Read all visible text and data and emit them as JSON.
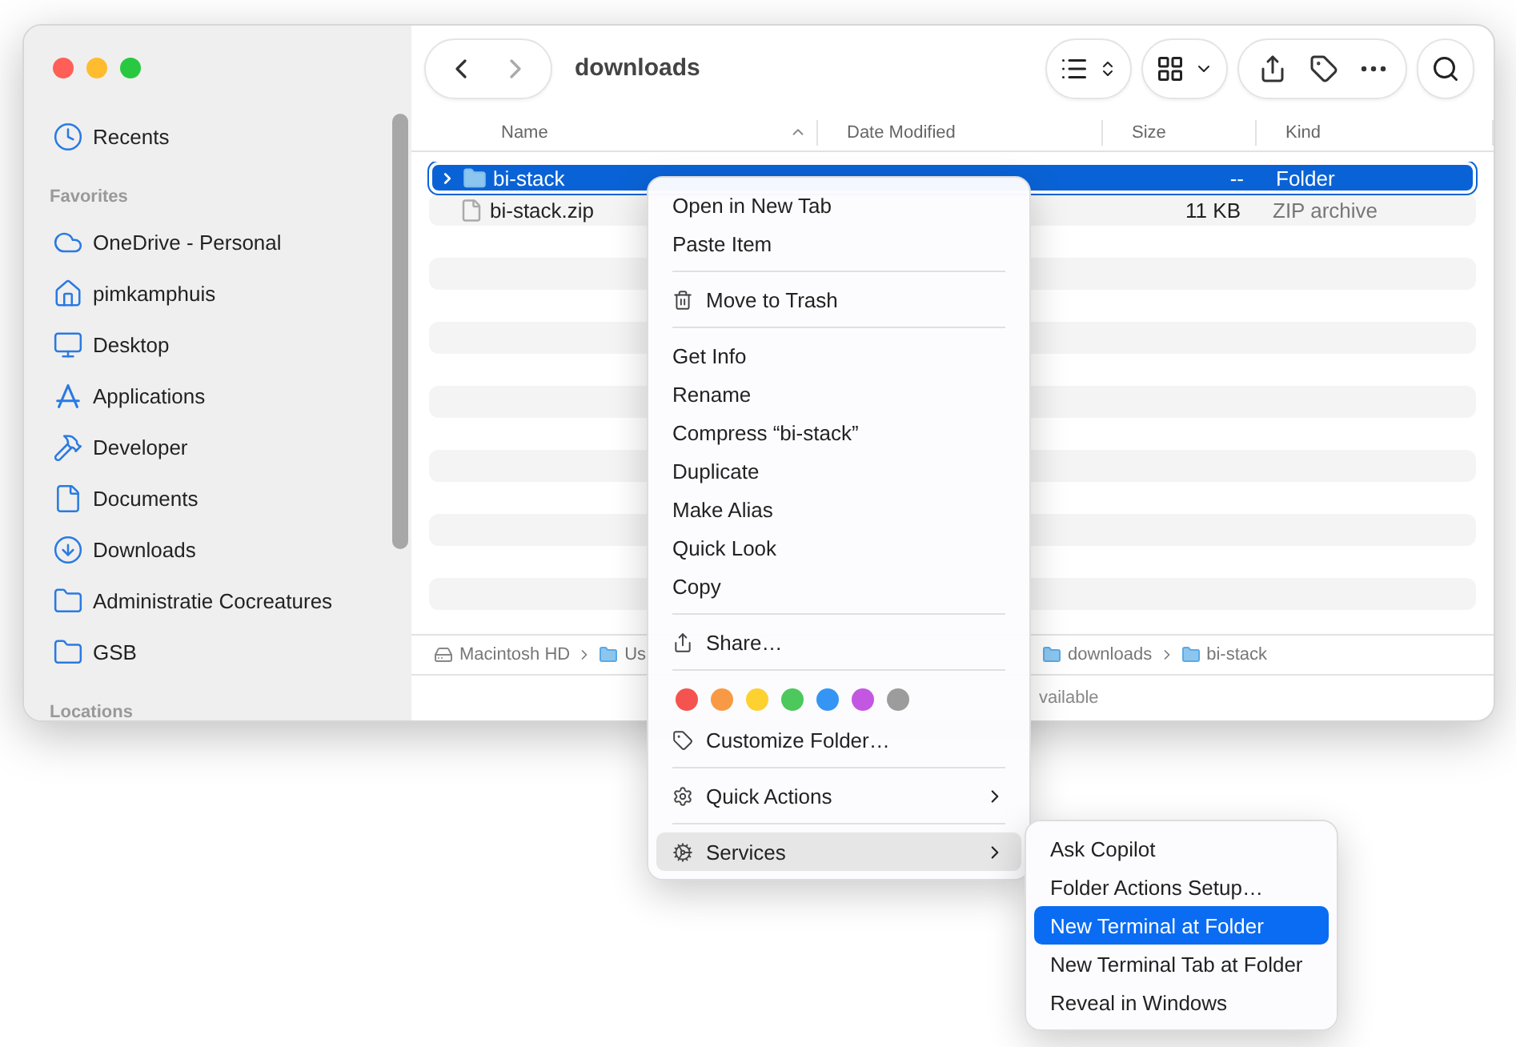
{
  "sidebar": {
    "sections": [
      {
        "items": [
          {
            "label": "Recents"
          }
        ]
      },
      {
        "title": "Favorites",
        "items": [
          {
            "label": "OneDrive - Personal"
          },
          {
            "label": "pimkamphuis"
          },
          {
            "label": "Desktop"
          },
          {
            "label": "Applications"
          },
          {
            "label": "Developer"
          },
          {
            "label": "Documents"
          },
          {
            "label": "Downloads"
          },
          {
            "label": "Administratie Cocreatures"
          },
          {
            "label": "GSB"
          }
        ]
      },
      {
        "title": "Locations"
      }
    ]
  },
  "toolbar": {
    "title": "downloads"
  },
  "table": {
    "columns": [
      {
        "label": "Name",
        "sorted": true
      },
      {
        "label": "Date Modified",
        "sorted": false
      },
      {
        "label": "Size",
        "sorted": false
      },
      {
        "label": "Kind",
        "sorted": false
      }
    ],
    "rows": [
      {
        "name": "bi-stack",
        "size": "--",
        "kind": "Folder",
        "selected": true
      },
      {
        "name": "bi-stack.zip",
        "size": "11 KB",
        "kind": "ZIP archive",
        "selected": false
      }
    ]
  },
  "path_bar": [
    {
      "label": "Macintosh HD"
    },
    {
      "label": "Us"
    },
    {
      "label": "downloads"
    },
    {
      "label": "bi-stack"
    }
  ],
  "status_bar": "vailable",
  "context_menu": {
    "groups": [
      [
        {
          "kind": "item",
          "label": "Open in New Tab"
        },
        {
          "kind": "item",
          "label": "Paste Item"
        }
      ],
      [
        {
          "kind": "item",
          "label": "Move to Trash"
        }
      ],
      [
        {
          "kind": "item",
          "label": "Get Info"
        },
        {
          "kind": "item",
          "label": "Rename"
        },
        {
          "kind": "item",
          "label": "Compress “bi-stack”"
        },
        {
          "kind": "item",
          "label": "Duplicate"
        },
        {
          "kind": "item",
          "label": "Make Alias"
        },
        {
          "kind": "item",
          "label": "Quick Look"
        },
        {
          "kind": "item",
          "label": "Copy"
        }
      ],
      [
        {
          "kind": "item",
          "label": "Share…"
        }
      ],
      [
        {
          "kind": "tags",
          "tags": [
            {
              "color": "#f5534f"
            },
            {
              "color": "#f89a45"
            },
            {
              "color": "#fdd130"
            },
            {
              "color": "#4cc85d"
            },
            {
              "color": "#3595f5"
            },
            {
              "color": "#c457e1"
            },
            {
              "color": "#9c9c9c"
            }
          ]
        },
        {
          "kind": "item",
          "label": "Customize Folder…"
        }
      ],
      [
        {
          "kind": "item",
          "label": "Quick Actions",
          "submenu": true,
          "selected": false
        }
      ],
      [
        {
          "kind": "item",
          "label": "Services",
          "submenu": true,
          "selected": true
        }
      ]
    ]
  },
  "services_menu": {
    "items": [
      {
        "label": "Ask Copilot",
        "selected": false
      },
      {
        "label": "Folder Actions Setup…",
        "selected": false
      },
      {
        "label": "New Terminal at Folder",
        "selected": true
      },
      {
        "label": "New Terminal Tab at Folder",
        "selected": false
      },
      {
        "label": "Reveal in Windows",
        "selected": false
      }
    ]
  }
}
